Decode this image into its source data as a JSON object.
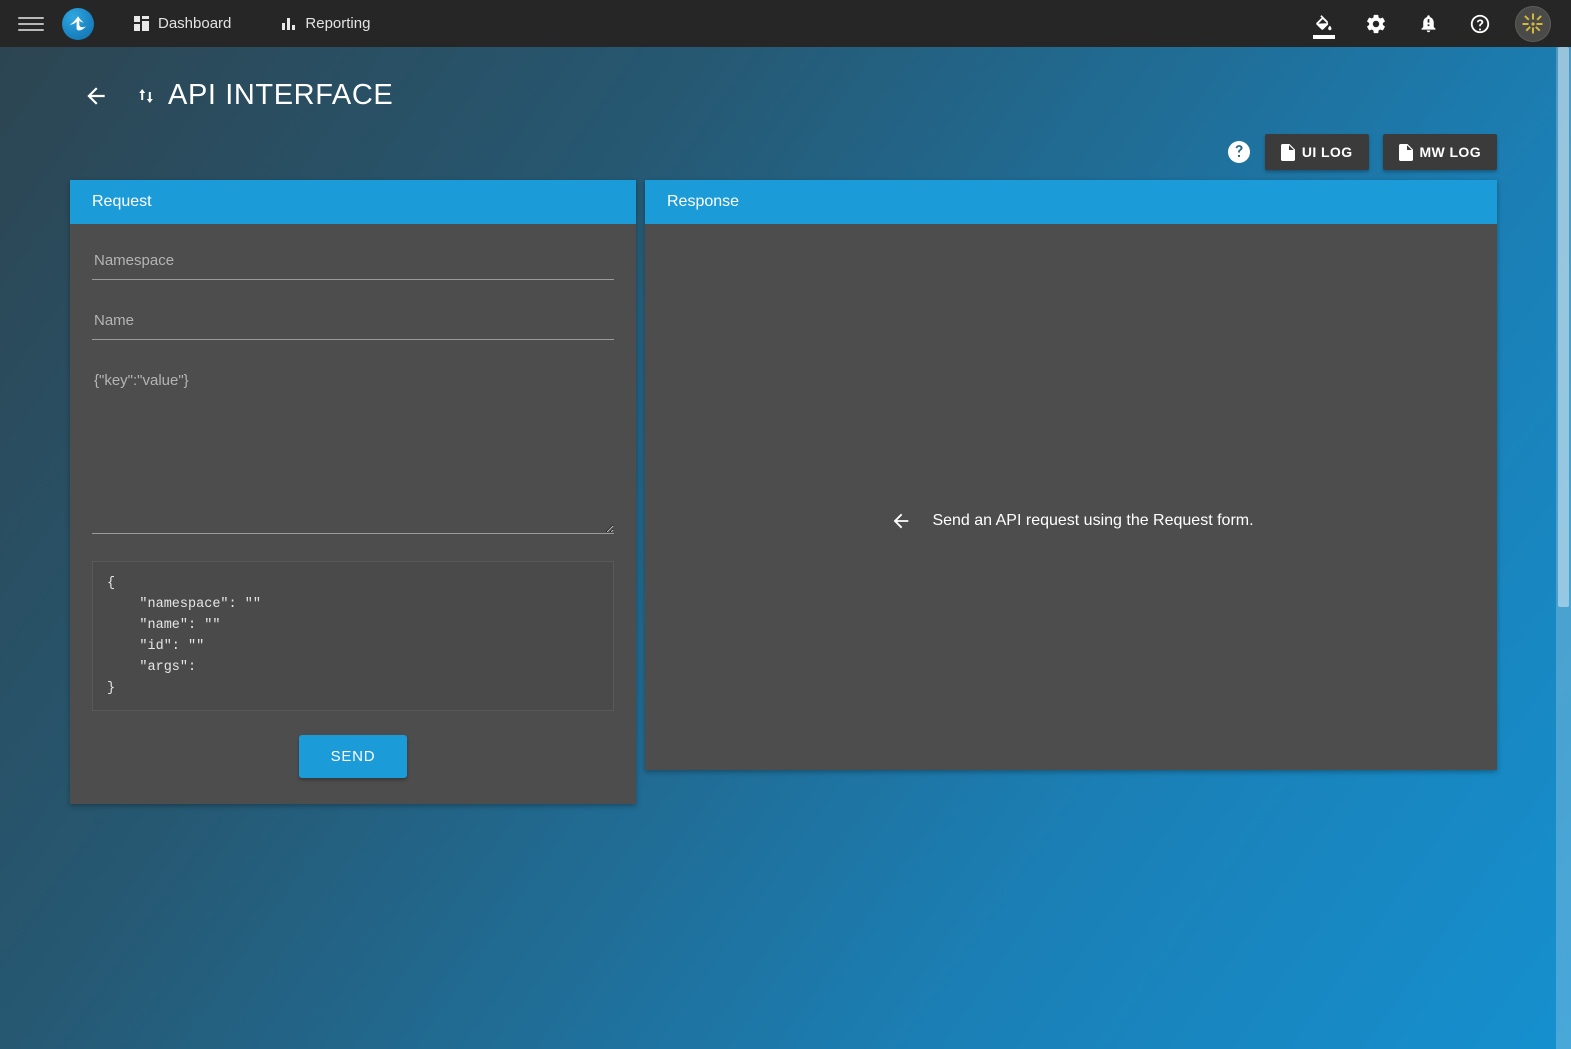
{
  "topbar": {
    "menu_icon": "hamburger-icon",
    "logo_icon": "brand-logo-icon",
    "nav": [
      {
        "label": "Dashboard",
        "icon": "dashboard-grid-icon"
      },
      {
        "label": "Reporting",
        "icon": "bar-chart-icon"
      }
    ],
    "right_icons": [
      {
        "name": "theme-paint-icon",
        "active": true
      },
      {
        "name": "settings-gear-icon",
        "active": false
      },
      {
        "name": "notifications-bell-icon",
        "active": false
      },
      {
        "name": "help-circle-icon",
        "active": false
      }
    ],
    "avatar": "user-avatar"
  },
  "page": {
    "back_label": "back-arrow-icon",
    "title_icon": "sort-arrows-icon",
    "title": "API INTERFACE"
  },
  "actionbar": {
    "help_icon": "help-circle-icon",
    "ui_log_label": "UI LOG",
    "mw_log_label": "MW LOG",
    "log_icon": "document-icon"
  },
  "request": {
    "panel_title": "Request",
    "namespace": {
      "value": "",
      "placeholder": "Namespace"
    },
    "name": {
      "value": "",
      "placeholder": "Name"
    },
    "args": {
      "value": "",
      "placeholder": "{\"key\":\"value\"}"
    },
    "preview": "{\n    \"namespace\": \"\"\n    \"name\": \"\"\n    \"id\": \"\"\n    \"args\":\n}",
    "send_label": "SEND"
  },
  "response": {
    "panel_title": "Response",
    "empty_icon": "arrow-left-icon",
    "empty_message": "Send an API request using the Request form."
  },
  "colors": {
    "accent": "#1b9bd8",
    "panel_bg": "#4d4d4d",
    "topbar_bg": "#262626",
    "button_bg": "#3b3b3b",
    "bg_gradient_start": "#2d4450",
    "bg_gradient_end": "#1590cf"
  }
}
